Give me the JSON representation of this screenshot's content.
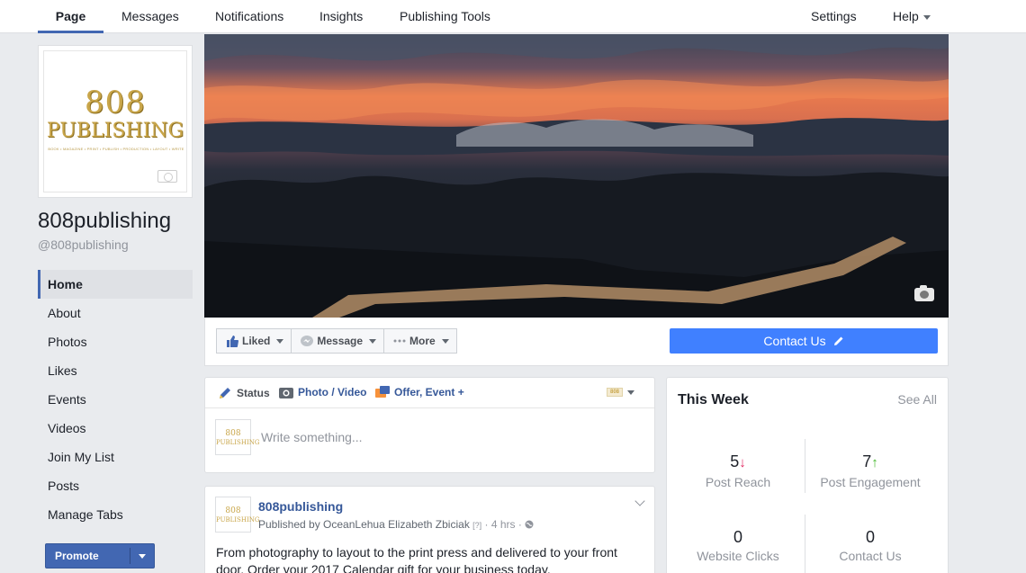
{
  "topnav": {
    "tabs": [
      "Page",
      "Messages",
      "Notifications",
      "Insights",
      "Publishing Tools"
    ],
    "settings": "Settings",
    "help": "Help"
  },
  "profile": {
    "logo_main": "808",
    "logo_sub": "PUBLISHING",
    "logo_tagline": "BOOK • MAGAZINE • PRINT • PUBLISH • PRODUCTION • LAYOUT • WRITE",
    "name": "808publishing",
    "handle": "@808publishing"
  },
  "sidebar": {
    "items": [
      "Home",
      "About",
      "Photos",
      "Likes",
      "Events",
      "Videos",
      "Join My List",
      "Posts",
      "Manage Tabs"
    ],
    "active": "Home",
    "promote": "Promote"
  },
  "actions": {
    "liked": "Liked",
    "message": "Message",
    "more": "More",
    "contact": "Contact Us"
  },
  "composer": {
    "status": "Status",
    "photo_video": "Photo / Video",
    "offer_event": "Offer, Event +",
    "placeholder": "Write something..."
  },
  "post": {
    "author": "808publishing",
    "published_by_prefix": "Published by ",
    "publisher": "OceanLehua Elizabeth Zbiciak",
    "help": "[?]",
    "time": "4 hrs",
    "text": "From photography to layout to the print press and delivered to your front door. Order your 2017 Calendar gift for your business today."
  },
  "this_week": {
    "title": "This Week",
    "see_all": "See All",
    "stats": [
      {
        "value": "5",
        "label": "Post Reach",
        "trend": "down"
      },
      {
        "value": "7",
        "label": "Post Engagement",
        "trend": "up"
      },
      {
        "value": "0",
        "label": "Website Clicks",
        "trend": "none"
      },
      {
        "value": "0",
        "label": "Contact Us",
        "trend": "none"
      }
    ]
  },
  "colors": {
    "brand_blue": "#4267b2",
    "cta_blue": "#4080ff",
    "link_blue": "#365899",
    "logo_gold": "#c9a64a",
    "trend_down": "#e0245e",
    "trend_up": "#42b72a"
  }
}
